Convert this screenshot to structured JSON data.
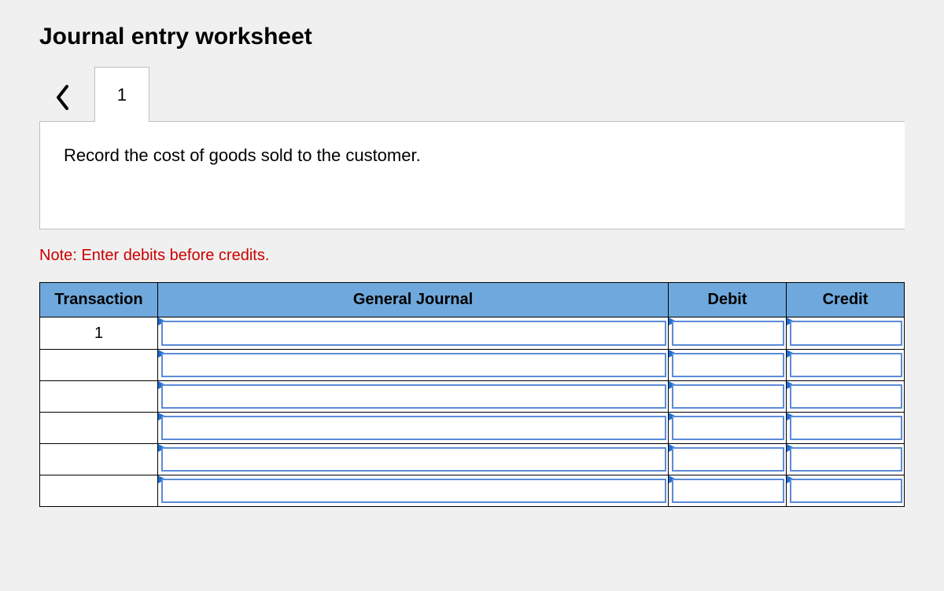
{
  "title": "Journal entry worksheet",
  "tabs": [
    "1"
  ],
  "instruction": "Record the cost of goods sold to the customer.",
  "note": "Note: Enter debits before credits.",
  "table": {
    "headers": {
      "transaction": "Transaction",
      "general_journal": "General Journal",
      "debit": "Debit",
      "credit": "Credit"
    },
    "rows": [
      {
        "transaction": "1",
        "general_journal": "",
        "debit": "",
        "credit": ""
      },
      {
        "transaction": "",
        "general_journal": "",
        "debit": "",
        "credit": ""
      },
      {
        "transaction": "",
        "general_journal": "",
        "debit": "",
        "credit": ""
      },
      {
        "transaction": "",
        "general_journal": "",
        "debit": "",
        "credit": ""
      },
      {
        "transaction": "",
        "general_journal": "",
        "debit": "",
        "credit": ""
      },
      {
        "transaction": "",
        "general_journal": "",
        "debit": "",
        "credit": ""
      }
    ]
  }
}
